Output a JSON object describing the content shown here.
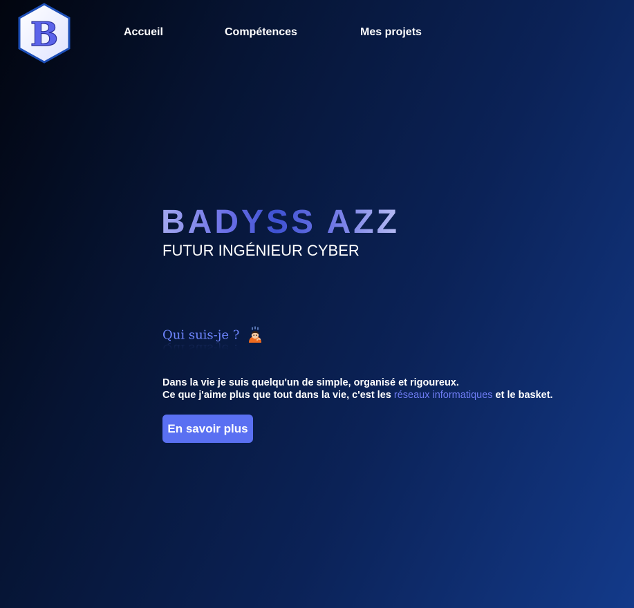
{
  "logo": {
    "letter": "B",
    "icon": "hexagon-b-logo-icon"
  },
  "nav": {
    "items": [
      {
        "label": "Accueil"
      },
      {
        "label": "Compétences"
      },
      {
        "label": "Mes projets"
      }
    ]
  },
  "hero": {
    "name": "BADYSS AZZ",
    "subtitle": "FUTUR INGÉNIEUR CYBER"
  },
  "about": {
    "title": "Qui suis-je ?",
    "icon": "person-thinking-icon",
    "line1": "Dans la vie je suis quelqu'un de simple, organisé et rigoureux.",
    "line2_prefix": "Ce que j'aime plus que tout dans la vie, c'est les ",
    "line2_highlight": "réseaux informatiques",
    "line2_suffix": " et le basket.",
    "button_label": "En savoir plus"
  },
  "colors": {
    "background_dark": "#02050f",
    "background_light": "#133a8a",
    "accent": "#5a70f2",
    "highlight_text": "#6f7df5"
  }
}
